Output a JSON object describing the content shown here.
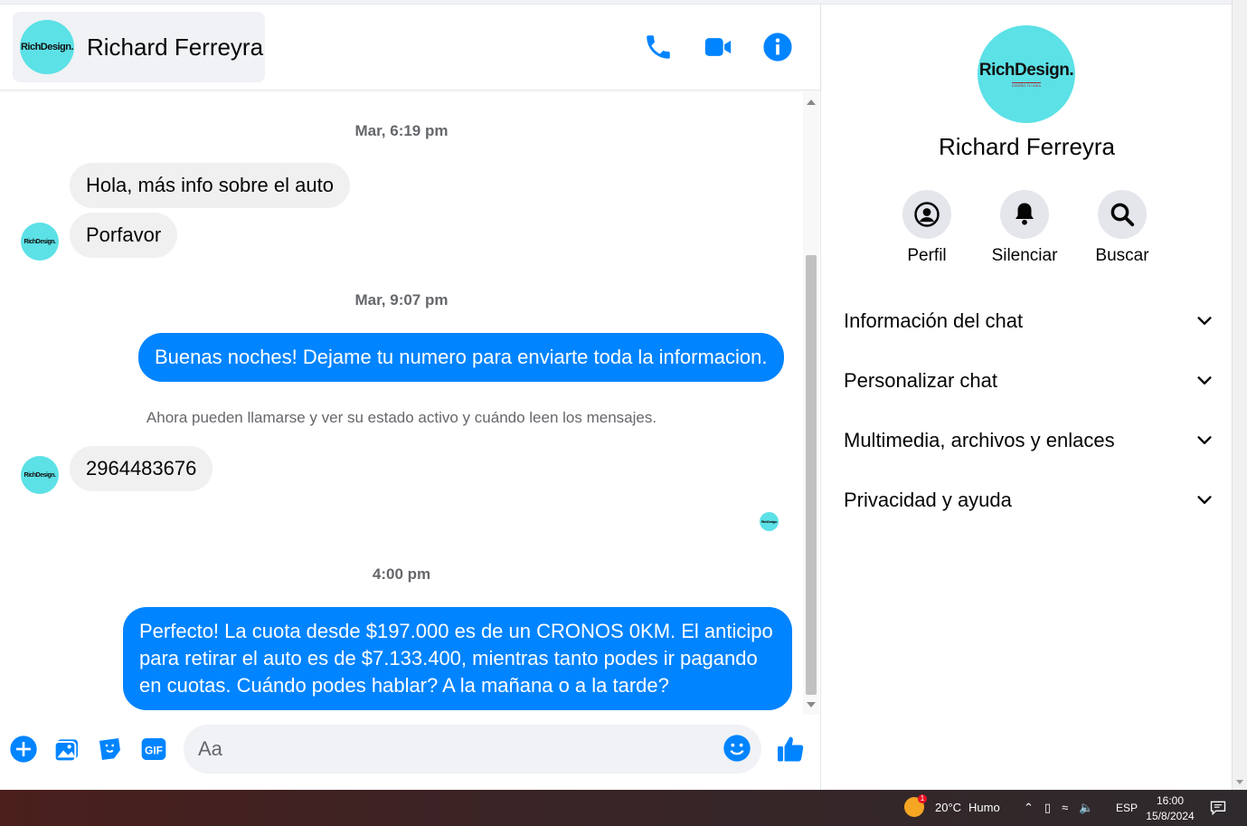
{
  "header": {
    "contact_name": "Richard Ferreyra",
    "avatar_brand": "RichDesign.",
    "avatar_tagline": "DISEÑO TU IDEA"
  },
  "messages": {
    "ts1": "Mar, 6:19 pm",
    "in1": "Hola, más info sobre el auto",
    "in2": "Porfavor",
    "ts2": "Mar, 9:07 pm",
    "out1": "Buenas noches! Dejame tu numero para enviarte toda la informacion.",
    "notice": "Ahora pueden llamarse y ver su estado activo y cuándo leen los mensajes.",
    "in3": "2964483676",
    "ts3": "4:00 pm",
    "out2": "Perfecto! La cuota desde $197.000 es de un CRONOS 0KM. El anticipo para retirar el auto es de $7.133.400, mientras tanto podes ir pagando en cuotas. Cuándo podes hablar? A la mañana o a la tarde?"
  },
  "composer": {
    "placeholder": "Aa"
  },
  "info_panel": {
    "name": "Richard Ferreyra",
    "actions": [
      "Perfil",
      "Silenciar",
      "Buscar"
    ],
    "sections": [
      "Información del chat",
      "Personalizar chat",
      "Multimedia, archivos y enlaces",
      "Privacidad y ayuda"
    ]
  },
  "taskbar": {
    "temperature": "20°C",
    "weather": "Humo",
    "weather_badge": "1",
    "language": "ESP",
    "time": "16:00",
    "date": "15/8/2024"
  },
  "colors": {
    "accent": "#0084ff",
    "incoming_bubble": "#f0f0f0",
    "avatar_bg": "#5ce1e6"
  }
}
